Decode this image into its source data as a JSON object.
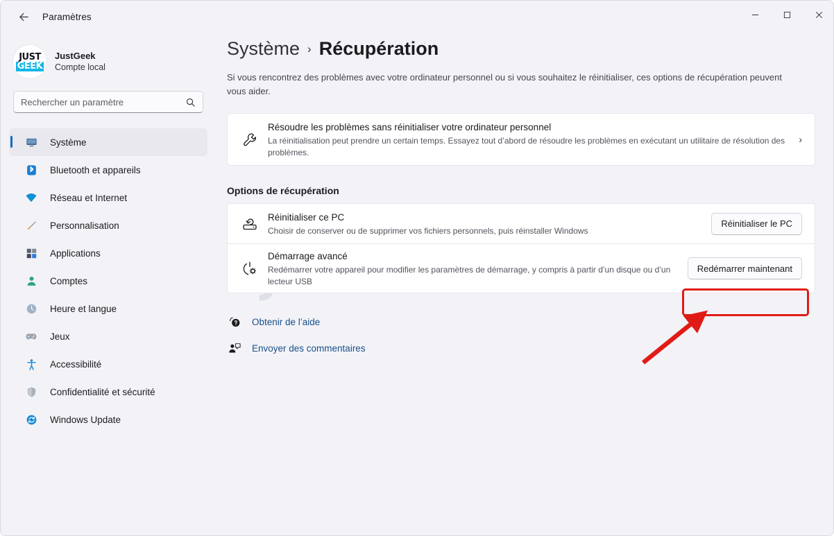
{
  "window": {
    "title": "Paramètres",
    "back_icon": "back-arrow-icon",
    "minimize_label": "—",
    "maximize_label": "□",
    "close_label": "✕"
  },
  "sidebar": {
    "account": {
      "logo_top": "JUST",
      "logo_bottom": "GEEK",
      "name": "JustGeek",
      "subtitle": "Compte local"
    },
    "search": {
      "placeholder": "Rechercher un paramètre",
      "value": "",
      "icon": "search-icon"
    },
    "items": [
      {
        "label": "Système",
        "icon": "monitor-icon",
        "active": true
      },
      {
        "label": "Bluetooth et appareils",
        "icon": "bluetooth-icon",
        "active": false
      },
      {
        "label": "Réseau et Internet",
        "icon": "wifi-icon",
        "active": false
      },
      {
        "label": "Personnalisation",
        "icon": "paintbrush-icon",
        "active": false
      },
      {
        "label": "Applications",
        "icon": "apps-icon",
        "active": false
      },
      {
        "label": "Comptes",
        "icon": "person-icon",
        "active": false
      },
      {
        "label": "Heure et langue",
        "icon": "clock-icon",
        "active": false
      },
      {
        "label": "Jeux",
        "icon": "gamepad-icon",
        "active": false
      },
      {
        "label": "Accessibilité",
        "icon": "accessibility-icon",
        "active": false
      },
      {
        "label": "Confidentialité et sécurité",
        "icon": "shield-icon",
        "active": false
      },
      {
        "label": "Windows Update",
        "icon": "update-icon",
        "active": false
      }
    ]
  },
  "main": {
    "breadcrumb": {
      "parent": "Système",
      "separator": "›",
      "current": "Récupération"
    },
    "description": "Si vous rencontrez des problèmes avec votre ordinateur personnel ou si vous souhaitez le réinitialiser, ces options de récupération peuvent vous aider.",
    "troubleshoot_card": {
      "icon": "wrench-icon",
      "title": "Résoudre les problèmes sans réinitialiser votre ordinateur personnel",
      "subtitle": "La réinitialisation peut prendre un certain temps. Essayez tout d’abord de résoudre les problèmes en exécutant un utilitaire de résolution des problèmes.",
      "chevron": "›"
    },
    "section_title": "Options de récupération",
    "options": [
      {
        "icon": "reset-pc-icon",
        "title": "Réinitialiser ce PC",
        "subtitle": "Choisir de conserver ou de supprimer vos fichiers personnels, puis réinstaller Windows",
        "button": "Réinitialiser le PC",
        "highlighted": false
      },
      {
        "icon": "advanced-startup-icon",
        "title": "Démarrage avancé",
        "subtitle": "Redémarrer votre appareil pour modifier les paramètres de démarrage, y compris à partir d’un disque ou d’un lecteur USB",
        "button": "Redémarrer maintenant",
        "highlighted": true
      }
    ],
    "links": [
      {
        "label": "Obtenir de l’aide",
        "icon": "help-icon"
      },
      {
        "label": "Envoyer des commentaires",
        "icon": "feedback-icon"
      }
    ]
  },
  "watermark": {
    "part1": "JUST",
    "part2": "GEEK"
  },
  "colors": {
    "accent": "#0f6cbd",
    "annotation_red": "#e01b16",
    "link": "#1a4f8b",
    "page_bg": "#f3f3f7",
    "card_bg": "#ffffff",
    "logo_cyan": "#12b6e8"
  }
}
